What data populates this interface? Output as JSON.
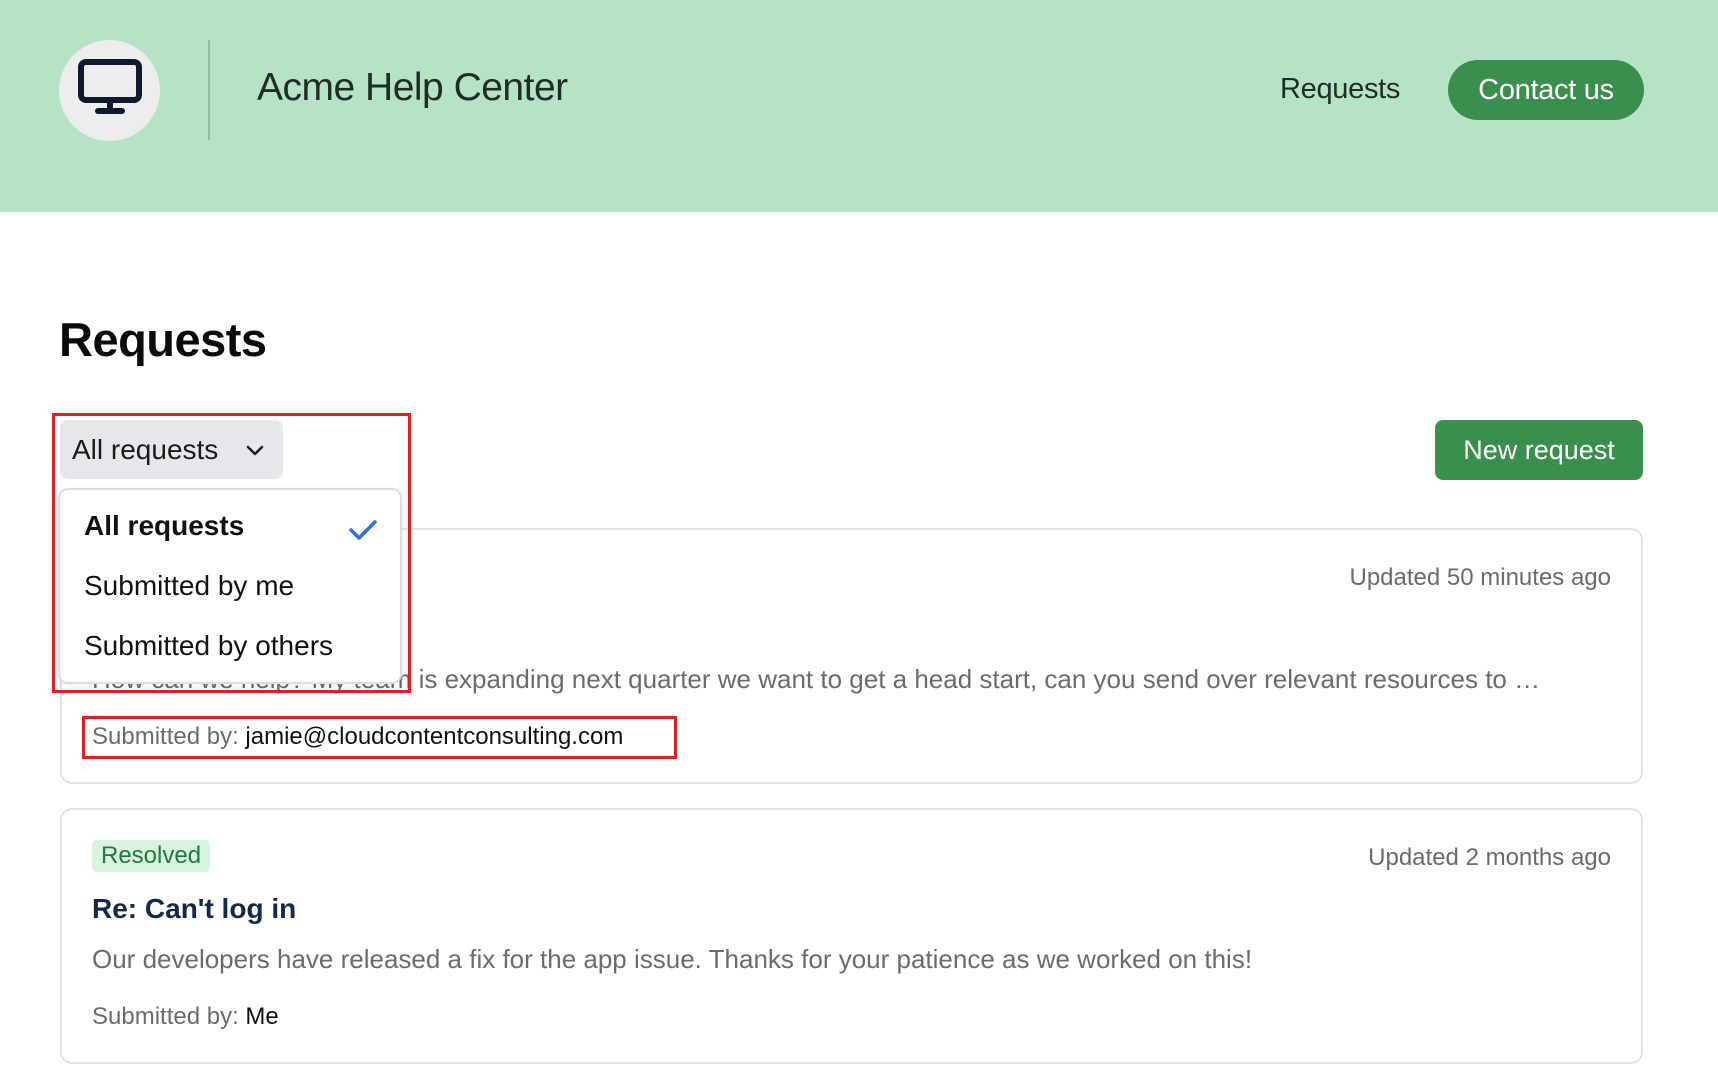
{
  "header": {
    "logo_icon": "monitor-icon",
    "brand": "Acme Help Center",
    "nav_requests": "Requests",
    "contact_label": "Contact us",
    "background_color": "#b6e3c6",
    "accent_color": "#3a8f4f"
  },
  "main": {
    "title": "Requests",
    "filter": {
      "selected_label": "All requests",
      "icon": "chevron-down-icon",
      "options": [
        {
          "label": "All requests",
          "selected": true
        },
        {
          "label": "Submitted by me",
          "selected": false
        },
        {
          "label": "Submitted by others",
          "selected": false
        }
      ],
      "check_icon": "checkmark-icon"
    },
    "new_request_label": "New request",
    "requests": [
      {
        "updated": "Updated 50 minutes ago",
        "preview": "How can we help? My team is expanding next quarter we want to get a head start, can you send over relevant resources to …",
        "submitted_label": "Submitted by:",
        "submitted_by": "jamie@cloudcontentconsulting.com"
      },
      {
        "status": "Resolved",
        "title": "Re: Can't log in",
        "updated": "Updated 2 months ago",
        "preview": "Our developers have released a fix for the app issue. Thanks for your patience as we worked on this!",
        "submitted_label": "Submitted by:",
        "submitted_by": "Me"
      }
    ]
  },
  "annotations": {
    "highlight_color": "#e02020"
  }
}
